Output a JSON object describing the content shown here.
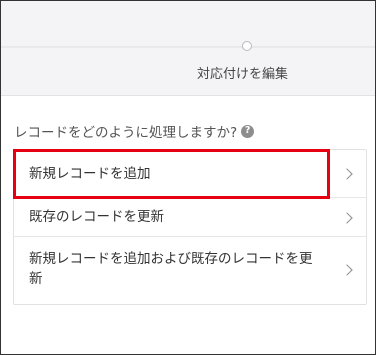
{
  "colors": {
    "highlight": "#e60012",
    "header_bg": "#f4f4f6",
    "text": "#333333"
  },
  "progress": {
    "step_label": "対応付けを編集"
  },
  "prompt": {
    "question": "レコードをどのように処理しますか?",
    "help_icon": "help-circle-icon",
    "help_glyph": "?"
  },
  "options": [
    {
      "label": "新規レコードを追加",
      "icon": "chevron-right-icon",
      "highlighted": true
    },
    {
      "label": "既存のレコードを更新",
      "icon": "chevron-right-icon"
    },
    {
      "label": "新規レコードを追加および既存のレコードを更新",
      "icon": "chevron-right-icon"
    }
  ]
}
